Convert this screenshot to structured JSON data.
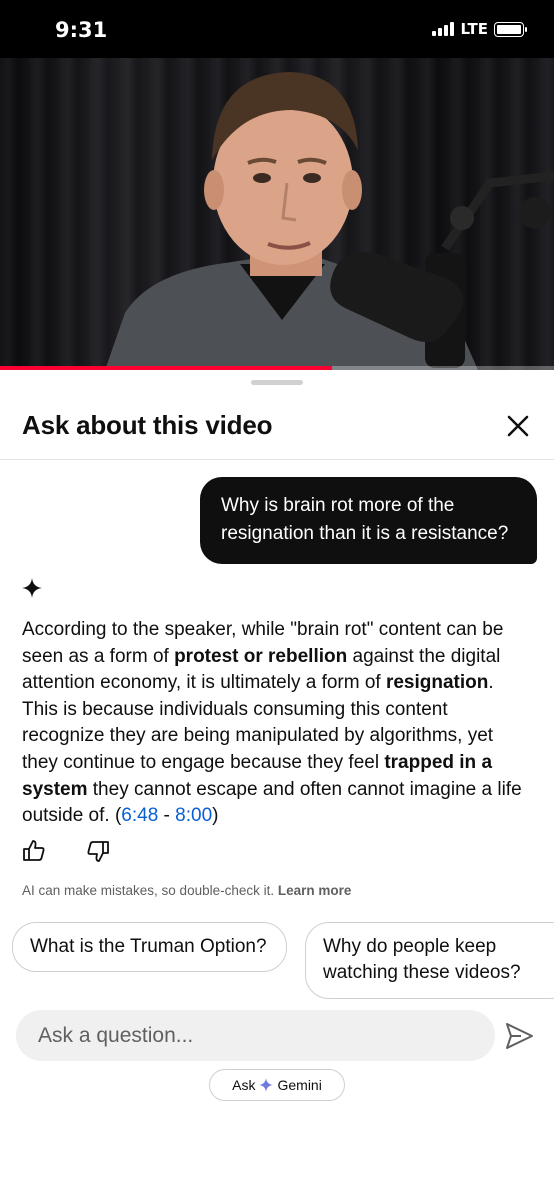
{
  "status_bar": {
    "time": "9:31",
    "network": "LTE",
    "battery_level": 1.0
  },
  "video": {
    "progress": 0.6
  },
  "sheet": {
    "title": "Ask about this video",
    "user_question": "Why is brain rot more of the resignation than it is a resistance?",
    "answer": {
      "p1": "According to the speaker, while \"brain rot\" content can be seen as a form of ",
      "b1": "protest or rebellion",
      "p2": " against the digital attention economy, it is ultimately a form of ",
      "b2": "resignation",
      "p3": ". This is because individuals consuming this content recognize they are being manipulated by algorithms, yet they continue to engage because they feel ",
      "b3": "trapped in a system",
      "p4": " they cannot escape and often cannot imagine a life outside of. (",
      "ts_start": "6:48",
      "ts_sep": " - ",
      "ts_end": "8:00",
      "p5": ")"
    },
    "disclaimer": "AI can make mistakes, so double-check it. ",
    "learn_more": "Learn more",
    "suggestions": [
      "What is the Truman Option?",
      "Why do people keep watching these videos?"
    ],
    "input_placeholder": "Ask a question...",
    "footer": {
      "ask": "Ask",
      "brand": "Gemini"
    }
  },
  "icons": {
    "close": "close-icon",
    "sparkle": "sparkle-icon",
    "thumb_up": "thumb-up-icon",
    "thumb_down": "thumb-down-icon",
    "send": "send-icon",
    "gemini": "gemini-star-icon"
  },
  "colors": {
    "accent_link": "#065fd4",
    "progress": "#ff0033",
    "bubble": "#0f0f0f"
  }
}
